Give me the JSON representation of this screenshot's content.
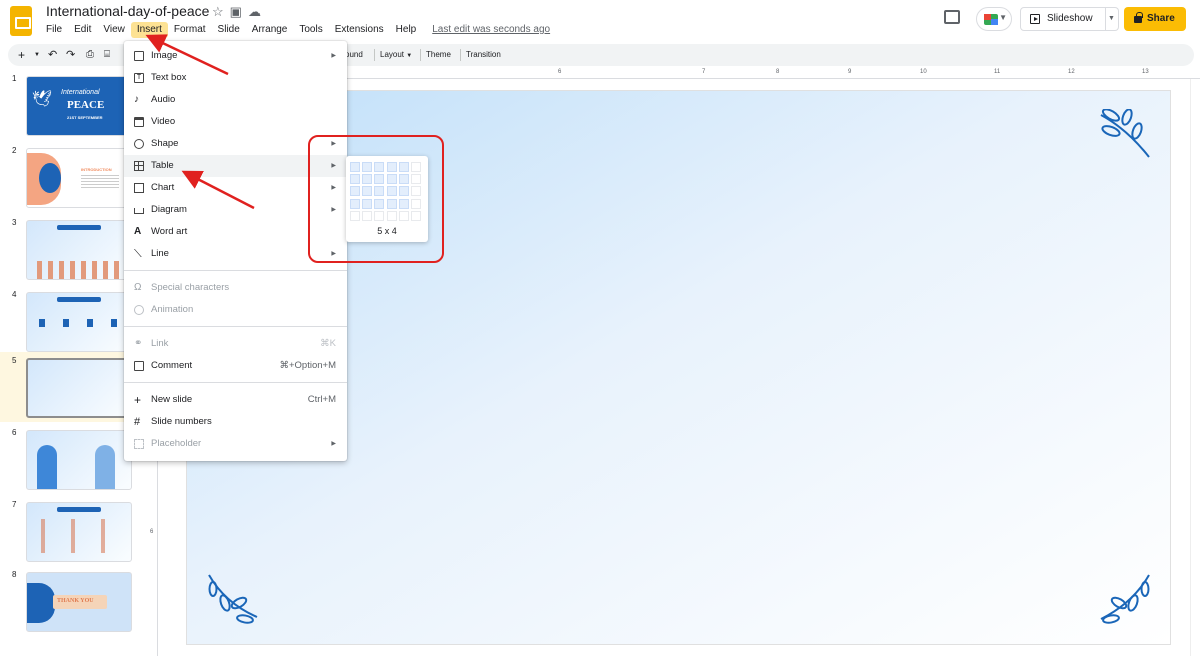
{
  "header": {
    "doc_title": "International-day-of-peace",
    "menu": [
      "File",
      "Edit",
      "View",
      "Insert",
      "Format",
      "Slide",
      "Arrange",
      "Tools",
      "Extensions",
      "Help"
    ],
    "active_menu": "Insert",
    "last_edit": "Last edit was seconds ago",
    "slideshow_label": "Slideshow",
    "share_label": "Share"
  },
  "toolbar": {
    "background_label": "ound",
    "layout_label": "Layout",
    "theme_label": "Theme",
    "transition_label": "Transition"
  },
  "ruler": {
    "top_ticks": [
      "6",
      "7",
      "8",
      "9",
      "10",
      "11",
      "12",
      "13"
    ],
    "left_ticks": [
      "6"
    ]
  },
  "insert_menu": {
    "items": [
      {
        "label": "Image",
        "icon": "image-icon",
        "submenu": true,
        "enabled": true
      },
      {
        "label": "Text box",
        "icon": "text-box-icon",
        "submenu": false,
        "enabled": true
      },
      {
        "label": "Audio",
        "icon": "audio-icon",
        "submenu": false,
        "enabled": true
      },
      {
        "label": "Video",
        "icon": "video-icon",
        "submenu": false,
        "enabled": true
      },
      {
        "label": "Shape",
        "icon": "shape-icon",
        "submenu": true,
        "enabled": true
      },
      {
        "label": "Table",
        "icon": "table-icon",
        "submenu": true,
        "enabled": true,
        "highlighted": true
      },
      {
        "label": "Chart",
        "icon": "chart-icon",
        "submenu": true,
        "enabled": true
      },
      {
        "label": "Diagram",
        "icon": "diagram-icon",
        "submenu": true,
        "enabled": true
      },
      {
        "label": "Word art",
        "icon": "word-art-icon",
        "submenu": false,
        "enabled": true
      },
      {
        "label": "Line",
        "icon": "line-icon",
        "submenu": true,
        "enabled": true
      },
      {
        "label": "Special characters",
        "icon": "omega-icon",
        "submenu": false,
        "enabled": false
      },
      {
        "label": "Animation",
        "icon": "animation-icon",
        "submenu": false,
        "enabled": false
      },
      {
        "label": "Link",
        "icon": "link-icon",
        "submenu": false,
        "enabled": false,
        "shortcut": "⌘K"
      },
      {
        "label": "Comment",
        "icon": "comment-icon",
        "submenu": false,
        "enabled": true,
        "shortcut": "⌘+Option+M"
      },
      {
        "label": "New slide",
        "icon": "plus-icon",
        "submenu": false,
        "enabled": true,
        "shortcut": "Ctrl+M"
      },
      {
        "label": "Slide numbers",
        "icon": "hash-icon",
        "submenu": false,
        "enabled": true
      },
      {
        "label": "Placeholder",
        "icon": "placeholder-icon",
        "submenu": true,
        "enabled": false
      }
    ]
  },
  "table_picker": {
    "columns_selected": 5,
    "rows_selected": 4,
    "label": "5 x 4"
  },
  "filmstrip": {
    "slides": [
      {
        "number": "1",
        "caption": "International",
        "title": "PEACE",
        "subtitle": "21ST SEPTEMBER"
      },
      {
        "number": "2",
        "caption": "INTRODUCTION"
      },
      {
        "number": "3"
      },
      {
        "number": "4"
      },
      {
        "number": "5",
        "selected": true
      },
      {
        "number": "6"
      },
      {
        "number": "7"
      },
      {
        "number": "8",
        "caption": "THANK YOU"
      }
    ]
  },
  "colors": {
    "accent": "#fbbc04",
    "annotation": "#e0211f",
    "menu_highlight": "#fde293",
    "slide_gradient_start": "#bfdff9",
    "leaf_blue": "#1a66b8"
  }
}
